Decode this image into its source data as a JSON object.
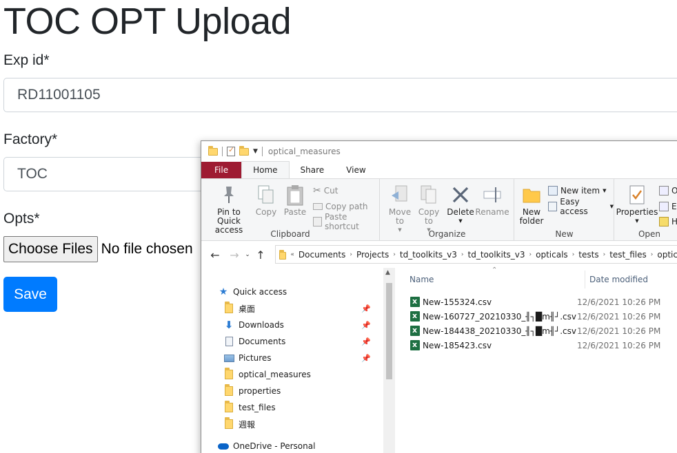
{
  "form": {
    "title": "TOC OPT Upload",
    "exp_label": "Exp id*",
    "exp_value": "RD11001105",
    "factory_label": "Factory*",
    "factory_value": "TOC",
    "opts_label": "Opts*",
    "choose_files": "Choose Files",
    "no_file": "No file chosen",
    "save": "Save"
  },
  "explorer": {
    "title": "optical_measures",
    "tabs": [
      "File",
      "Home",
      "Share",
      "View"
    ],
    "ribbon": {
      "clipboard": {
        "pin": "Pin to Quick access",
        "copy": "Copy",
        "paste": "Paste",
        "cut": "Cut",
        "copy_path": "Copy path",
        "paste_shortcut": "Paste shortcut",
        "label": "Clipboard"
      },
      "organize": {
        "move_to": "Move to",
        "copy_to": "Copy to",
        "delete": "Delete",
        "rename": "Rename",
        "label": "Organize"
      },
      "new": {
        "new_folder": "New folder",
        "new_item": "New item",
        "easy_access": "Easy access",
        "label": "New"
      },
      "open": {
        "properties": "Properties",
        "label": "Open",
        "o": "O",
        "e": "E",
        "h": "H"
      }
    },
    "path": [
      "Documents",
      "Projects",
      "td_toolkits_v3",
      "td_toolkits_v3",
      "opticals",
      "tests",
      "test_files",
      "optic"
    ],
    "nav": [
      {
        "label": "Quick access",
        "icon": "star-icon",
        "pinned": false
      },
      {
        "label": "桌面",
        "icon": "folder-icon",
        "pinned": true
      },
      {
        "label": "Downloads",
        "icon": "download-arrow-icon",
        "pinned": true
      },
      {
        "label": "Documents",
        "icon": "document-icon",
        "pinned": true
      },
      {
        "label": "Pictures",
        "icon": "pictures-icon",
        "pinned": true
      },
      {
        "label": "optical_measures",
        "icon": "folder-icon",
        "pinned": false
      },
      {
        "label": "properties",
        "icon": "folder-icon",
        "pinned": false
      },
      {
        "label": "test_files",
        "icon": "folder-icon",
        "pinned": false
      },
      {
        "label": "週報",
        "icon": "folder-icon",
        "pinned": false
      },
      {
        "label": "OneDrive - Personal",
        "icon": "cloud-icon",
        "pinned": false
      }
    ],
    "columns": {
      "name": "Name",
      "date": "Date modified"
    },
    "files": [
      {
        "name": "New-155324.csv",
        "date": "12/6/2021 10:26 PM"
      },
      {
        "name": "New-160727_20210330_╢┐█m╢┘.csv",
        "date": "12/6/2021 10:26 PM"
      },
      {
        "name": "New-184438_20210330_╢┐█m╢┘.csv",
        "date": "12/6/2021 10:26 PM"
      },
      {
        "name": "New-185423.csv",
        "date": "12/6/2021 10:26 PM"
      }
    ]
  },
  "colors": {
    "save_button": "#007bff",
    "file_tab": "#9e1b32",
    "excel_green": "#1d6f42"
  }
}
